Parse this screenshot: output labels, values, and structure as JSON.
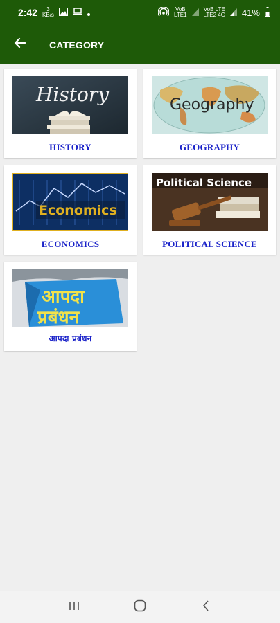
{
  "status": {
    "time": "2:42",
    "network_small": "3",
    "network_small_sub": "KB/s",
    "sim1_top": "VoB",
    "sim1_bottom": "LTE1",
    "sim2_top": "VoB LTE",
    "sim2_bottom": "LTE2 4G",
    "battery": "41%"
  },
  "appbar": {
    "title": "CATEGORY",
    "back_icon": "arrow-left-icon"
  },
  "categories": [
    {
      "label": "HISTORY",
      "thumb_text": "History"
    },
    {
      "label": "GEOGRAPHY",
      "thumb_text": "Geography"
    },
    {
      "label": "ECONOMICS",
      "thumb_text": "Economics"
    },
    {
      "label": "POLITICAL SCIENCE",
      "thumb_text": "Political Science"
    },
    {
      "label": "आपदा प्रबंधन",
      "thumb_line1": "आपदा",
      "thumb_line2": "प्रबंधन"
    }
  ],
  "nav": {
    "recent_icon": "recent-apps-icon",
    "home_icon": "home-icon",
    "back_icon": "back-icon"
  },
  "colors": {
    "appbar": "#1e5a08",
    "label": "#1a22c9",
    "background": "#efefef"
  }
}
